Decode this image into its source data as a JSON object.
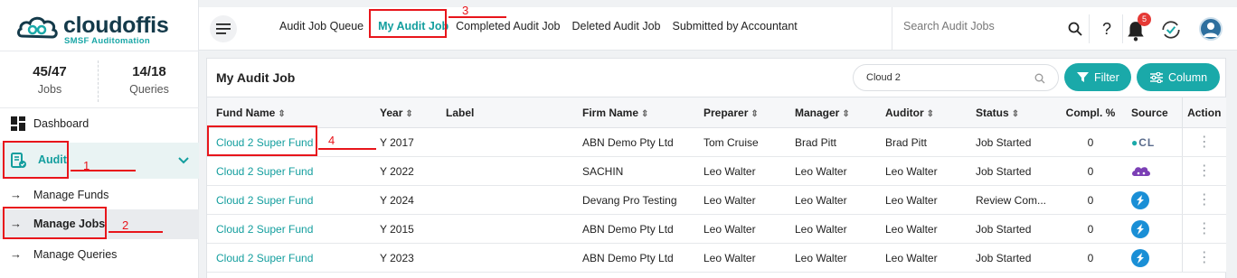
{
  "brand": {
    "name": "cloudoffis",
    "tagline": "SMSF Auditomation",
    "primary_color": "#1aa9a9",
    "dark_color": "#143a4a"
  },
  "stats": [
    {
      "value": "45/47",
      "label": "Jobs"
    },
    {
      "value": "14/18",
      "label": "Queries"
    }
  ],
  "sidebar": {
    "dashboard": "Dashboard",
    "audit": "Audit",
    "sub_items": [
      "Manage Funds",
      "Manage Jobs",
      "Manage Queries"
    ]
  },
  "topbar": {
    "tabs": [
      "Audit Job Queue",
      "My Audit Job",
      "Completed Audit Job",
      "Deleted Audit Job",
      "Submitted by Accountant"
    ],
    "active_tab": "My Audit Job",
    "search_placeholder": "Search Audit Jobs",
    "notification_count": "5"
  },
  "card": {
    "title": "My Audit Job",
    "search_value": "Cloud 2",
    "filter_label": "Filter",
    "column_label": "Column"
  },
  "table": {
    "headers": [
      "Fund Name",
      "Year",
      "Label",
      "Firm Name",
      "Preparer",
      "Manager",
      "Auditor",
      "Status",
      "Compl. %",
      "Source",
      "Action"
    ],
    "rows": [
      {
        "fund": "Cloud 2 Super Fund",
        "year": "Y 2017",
        "label": "",
        "firm": "ABN Demo Pty Ltd",
        "preparer": "Tom Cruise",
        "manager": "Brad Pitt",
        "auditor": "Brad Pitt",
        "status": "Job Started",
        "compl": "0",
        "source": "class-icon"
      },
      {
        "fund": "Cloud 2 Super Fund",
        "year": "Y 2022",
        "label": "",
        "firm": "SACHIN",
        "preparer": "Leo Walter",
        "manager": "Leo Walter",
        "auditor": "Leo Walter",
        "status": "Job Started",
        "compl": "0",
        "source": "cloud-purple-icon"
      },
      {
        "fund": "Cloud 2 Super Fund",
        "year": "Y 2024",
        "label": "",
        "firm": "Devang Pro Testing",
        "preparer": "Leo Walter",
        "manager": "Leo Walter",
        "auditor": "Leo Walter",
        "status": "Review Com...",
        "compl": "0",
        "source": "sync-blue-icon"
      },
      {
        "fund": "Cloud 2 Super Fund",
        "year": "Y 2015",
        "label": "",
        "firm": "ABN Demo Pty Ltd",
        "preparer": "Leo Walter",
        "manager": "Leo Walter",
        "auditor": "Leo Walter",
        "status": "Job Started",
        "compl": "0",
        "source": "sync-blue-icon"
      },
      {
        "fund": "Cloud 2 Super Fund",
        "year": "Y 2023",
        "label": "",
        "firm": "ABN Demo Pty Ltd",
        "preparer": "Leo Walter",
        "manager": "Leo Walter",
        "auditor": "Leo Walter",
        "status": "Job Started",
        "compl": "0",
        "source": "sync-blue-icon"
      }
    ]
  },
  "annotations": {
    "n1": "1",
    "n2": "2",
    "n3": "3",
    "n4": "4",
    "color": "#e8151b"
  }
}
